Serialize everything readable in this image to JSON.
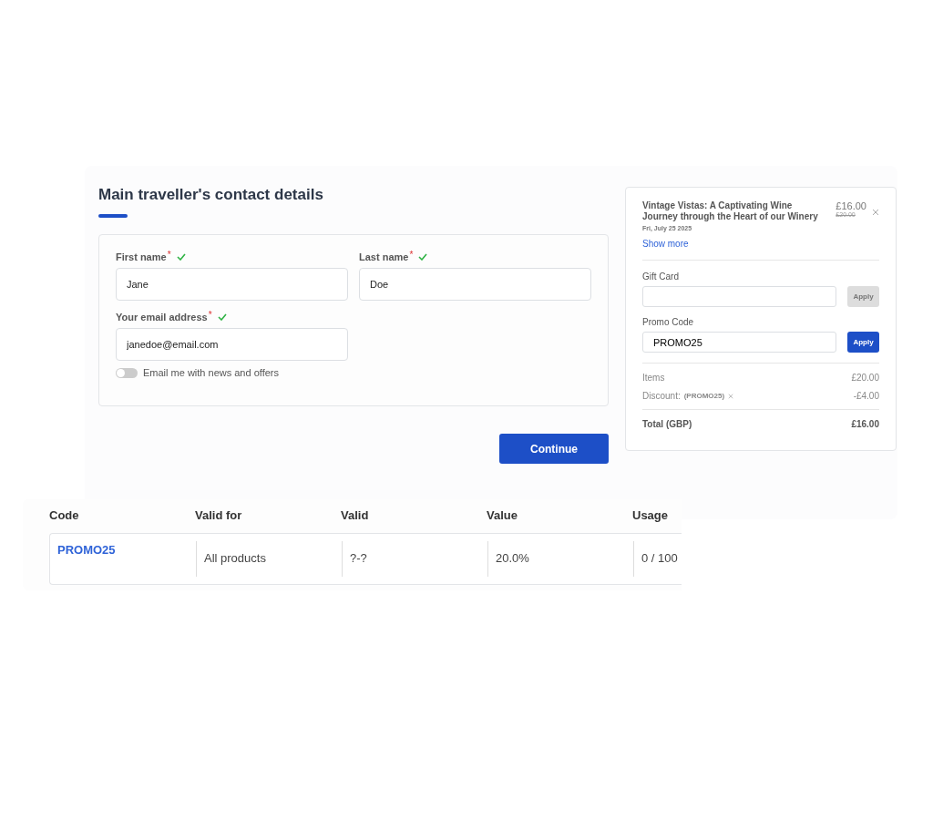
{
  "contact": {
    "title": "Main traveller's contact details",
    "fields": [
      {
        "label": "First name",
        "required_mark": "*",
        "valid": true,
        "value": "Jane"
      },
      {
        "label": "Last name",
        "required_mark": "*",
        "valid": true,
        "value": "Doe"
      },
      {
        "label": "Your email address",
        "required_mark": "*",
        "valid": true,
        "value": "janedoe@email.com"
      }
    ],
    "toggle": {
      "label": "Email me with news and offers",
      "on": false
    },
    "continue_button": "Continue"
  },
  "summary": {
    "item": {
      "title": "Vintage Vistas: A Captivating Wine Journey through the Heart of our Winery",
      "date": "Fri, July 25 2025",
      "price": "£16.00",
      "old_price": "£20.00",
      "show_more": "Show more"
    },
    "codes": [
      {
        "label": "Gift Card",
        "apply": "Apply",
        "disabled": true
      },
      {
        "label": "Promo Code",
        "value": "PROMO25",
        "apply": "Apply",
        "disabled": false
      }
    ],
    "lines": [
      {
        "label": "Items",
        "amount": "£20.00"
      },
      {
        "label": "Discount:",
        "code": "(PROMO25)",
        "amount": "-£4.00"
      }
    ],
    "total": {
      "label": "Total (GBP)",
      "amount": "£16.00"
    }
  },
  "table": {
    "columns": [
      "Code",
      "Valid for",
      "Valid",
      "Value",
      "Usage"
    ],
    "rows": [
      [
        "PROMO25",
        "All products",
        "?-?",
        "20.0%",
        "0 / 100"
      ]
    ]
  }
}
